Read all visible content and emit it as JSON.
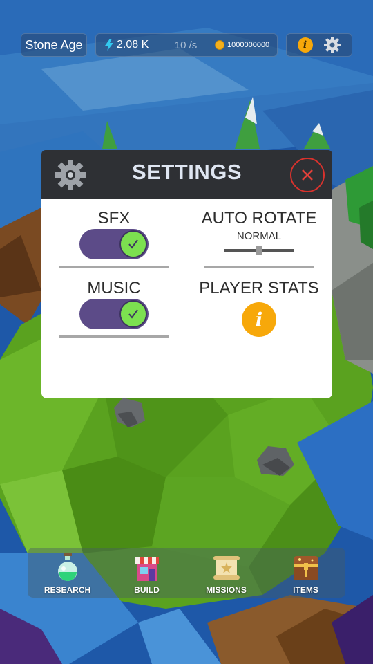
{
  "hud": {
    "era": "Stone Age",
    "energy": "2.08 K",
    "rate": "10 /s",
    "coins": "1000000000"
  },
  "settings": {
    "title": "SETTINGS",
    "sfx_label": "SFX",
    "sfx_on": true,
    "music_label": "MUSIC",
    "music_on": true,
    "auto_rotate_label": "AUTO ROTATE",
    "auto_rotate_value": "NORMAL",
    "player_stats_label": "PLAYER STATS"
  },
  "nav": [
    {
      "label": "RESEARCH",
      "icon": "potion-icon"
    },
    {
      "label": "BUILD",
      "icon": "shop-icon"
    },
    {
      "label": "MISSIONS",
      "icon": "scroll-icon"
    },
    {
      "label": "ITEMS",
      "icon": "chest-icon"
    }
  ],
  "colors": {
    "toggle_track": "#5c4b88",
    "toggle_knob": "#7ce050",
    "info": "#f7a80a",
    "close": "#d8322d",
    "header": "#2e3034"
  }
}
